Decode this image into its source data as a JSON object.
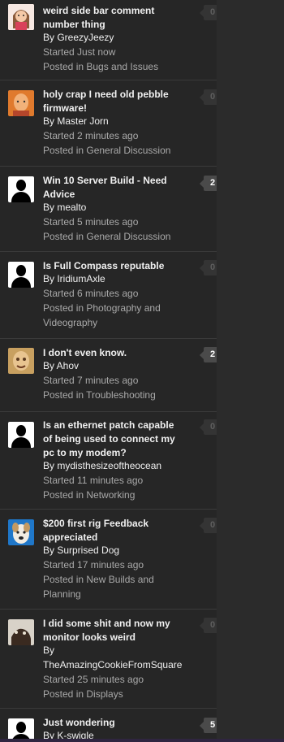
{
  "threads": [
    {
      "title": "weird side bar comment number thing",
      "by": "By GreezyJeezy",
      "started": "Started Just now",
      "posted": "Posted in Bugs and Issues",
      "replies": "0",
      "avatar_icon": "custom-avatar-cartoon-girl-icon"
    },
    {
      "title": "holy crap I need old pebble firmware!",
      "by": "By Master Jorn",
      "started": "Started 2 minutes ago",
      "posted": "Posted in General Discussion",
      "replies": "0",
      "avatar_icon": "custom-avatar-bald-man-icon"
    },
    {
      "title": "Win 10 Server Build - Need Advice",
      "by": "By mealto",
      "started": "Started 5 minutes ago",
      "posted": "Posted in General Discussion",
      "replies": "2",
      "avatar_icon": "default-avatar-icon"
    },
    {
      "title": "Is Full Compass reputable",
      "by": "By IridiumAxle",
      "started": "Started 6 minutes ago",
      "posted": "Posted in Photography and Videography",
      "replies": "0",
      "avatar_icon": "default-avatar-icon"
    },
    {
      "title": "I don't even know.",
      "by": "By Ahov",
      "started": "Started 7 minutes ago",
      "posted": "Posted in Troubleshooting",
      "replies": "2",
      "avatar_icon": "custom-avatar-photo-icon"
    },
    {
      "title": "Is an ethernet patch capable of being used to connect my pc to my modem?",
      "by": "By mydisthesizeoftheocean",
      "started": "Started 11 minutes ago",
      "posted": "Posted in Networking",
      "replies": "0",
      "avatar_icon": "default-avatar-icon"
    },
    {
      "title": "$200 first rig Feedback appreciated",
      "by": "By Surprised Dog",
      "started": "Started 17 minutes ago",
      "posted": "Posted in New Builds and Planning",
      "replies": "0",
      "avatar_icon": "custom-avatar-dog-icon"
    },
    {
      "title": "I did some shit and now my monitor looks weird",
      "by": "By TheAmazingCookieFromSquare",
      "started": "Started 25 minutes ago",
      "posted": "Posted in Displays",
      "replies": "0",
      "avatar_icon": "custom-avatar-cookie-icon"
    },
    {
      "title": "Just wondering",
      "by": "By K-swigle",
      "started": "",
      "posted": "",
      "replies": "5",
      "avatar_icon": "default-avatar-icon"
    }
  ],
  "colors": {
    "background": "#262626",
    "title_text": "#f0f0f0",
    "meta_text": "#a9a9a9",
    "badge_zero_bg": "#343434",
    "badge_active_bg": "#4a4a4a"
  }
}
